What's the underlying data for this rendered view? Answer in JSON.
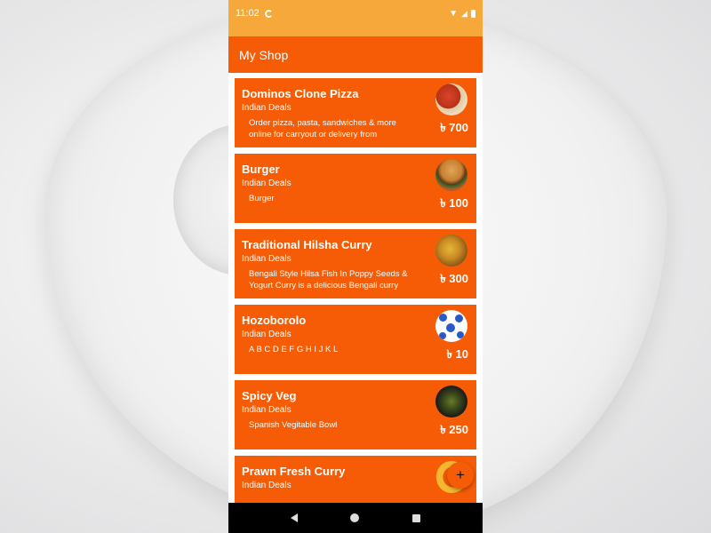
{
  "status_bar": {
    "time": "11:02"
  },
  "app_bar": {
    "title": "My Shop"
  },
  "products": [
    {
      "title": "Dominos Clone Pizza",
      "category": "Indian Deals",
      "description": "Order pizza, pasta, sandwiches & more online for carryout or delivery from",
      "price": "৳ 700",
      "thumb": "pizza-thumbnail"
    },
    {
      "title": "Burger",
      "category": "Indian Deals",
      "description": "Burger",
      "price": "৳ 100",
      "thumb": "burger-thumbnail"
    },
    {
      "title": "Traditional Hilsha Curry",
      "category": "Indian Deals",
      "description": "Bengali Style Hilsa Fish In Poppy Seeds & Yogurt Curry is a delicious Bengali curry",
      "price": "৳ 300",
      "thumb": "curry-thumbnail"
    },
    {
      "title": "Hozoborolo",
      "category": "Indian Deals",
      "description": "A B C D E F G H I J K L",
      "price": "৳ 10",
      "thumb": "logo-thumbnail"
    },
    {
      "title": "Spicy Veg",
      "category": "Indian Deals",
      "description": "Spanish Vegitable Bowl",
      "price": "৳ 250",
      "thumb": "veg-bowl-thumbnail"
    },
    {
      "title": "Prawn Fresh Curry",
      "category": "Indian Deals",
      "description": "",
      "price": "",
      "thumb": "prawn-thumbnail"
    }
  ],
  "fab": {
    "label": "+"
  },
  "colors": {
    "status_bar": "#f6a83a",
    "primary": "#f65c06",
    "nav_bar": "#000000"
  }
}
